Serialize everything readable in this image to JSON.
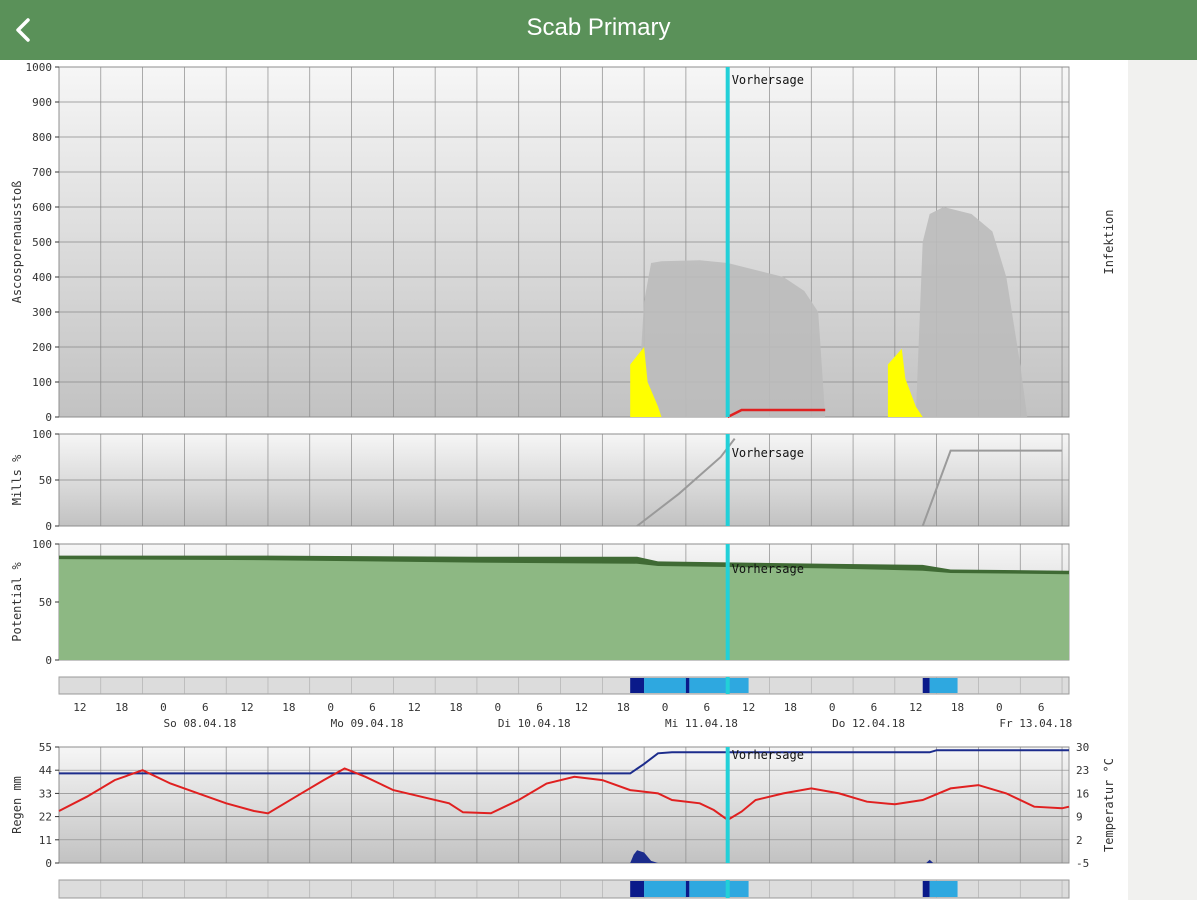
{
  "header": {
    "title": "Scab Primary",
    "back_icon": "chevron-left-icon"
  },
  "colors": {
    "header_bg": "#5a9159",
    "forecast_line": "#22d0d8",
    "ascospore": "#ffff00",
    "infection_area": "#bbbbbb",
    "infection_line": "#e02020",
    "potential_light": "#8db883",
    "potential_dark": "#3f6a34",
    "temperature": "#e02020",
    "humidity": "#1c2c8c",
    "wet_dark": "#0a1a8a",
    "wet_light": "#2ea8e0"
  },
  "forecast_label": "Vorhersage",
  "time_axis": {
    "hour_labels": [
      "12",
      "18",
      "0",
      "6",
      "12",
      "18",
      "0",
      "6",
      "12",
      "18",
      "0",
      "6",
      "12",
      "18",
      "0",
      "6",
      "12",
      "18",
      "0",
      "6",
      "12",
      "18",
      "0",
      "6"
    ],
    "day_labels": [
      "So 08.04.18",
      "Mo 09.04.18",
      "Di 10.04.18",
      "Mi 11.04.18",
      "Do 12.04.18",
      "Fr 13.04.18"
    ]
  },
  "chart_data": [
    {
      "type": "area",
      "ylabel": "Ascosporenausstoß",
      "ylabel_right": "Infektion",
      "ylim": [
        0,
        1000
      ],
      "y_ticks": [
        "0",
        "100",
        "200",
        "300",
        "400",
        "500",
        "600",
        "700",
        "800",
        "900",
        "1000"
      ],
      "forecast_label": "Vorhersage",
      "x_unit": "hours",
      "xlim": [
        0,
        145
      ],
      "forecast_x": 96,
      "grid": true,
      "series": [
        {
          "values_xy": [
            [
              82,
              0
            ],
            [
              82,
              150
            ],
            [
              84,
              200
            ],
            [
              84.5,
              100
            ],
            [
              86,
              30
            ],
            [
              86.5,
              0
            ]
          ]
        },
        {
          "values_xy": [
            [
              119,
              0
            ],
            [
              119,
              150
            ],
            [
              121,
              195
            ],
            [
              121.5,
              110
            ],
            [
              123,
              30
            ],
            [
              124,
              0
            ]
          ]
        },
        {
          "values_xy": [
            [
              83,
              0
            ],
            [
              84,
              330
            ],
            [
              85,
              440
            ],
            [
              86.5,
              445
            ],
            [
              92,
              448
            ],
            [
              96,
              440
            ],
            [
              100,
              420
            ],
            [
              104,
              400
            ],
            [
              107,
              360
            ],
            [
              109,
              300
            ],
            [
              110,
              0
            ]
          ]
        },
        {
          "values_xy": [
            [
              123,
              0
            ],
            [
              124,
              500
            ],
            [
              125,
              580
            ],
            [
              127,
              600
            ],
            [
              131,
              580
            ],
            [
              134,
              530
            ],
            [
              136,
              400
            ],
            [
              138,
              150
            ],
            [
              139,
              0
            ]
          ]
        },
        {
          "values_xy": [
            [
              96,
              0
            ],
            [
              98,
              20
            ],
            [
              110,
              20
            ]
          ]
        }
      ]
    },
    {
      "type": "line",
      "ylabel": "Mills %",
      "ylim": [
        0,
        100
      ],
      "y_ticks": [
        "0",
        "50",
        "100"
      ],
      "forecast_label": "Vorhersage",
      "x_unit": "hours",
      "xlim": [
        0,
        145
      ],
      "forecast_x": 96,
      "grid": true,
      "series": [
        {
          "values_xy": [
            [
              83,
              0
            ],
            [
              89,
              35
            ],
            [
              95,
              75
            ],
            [
              97,
              95
            ]
          ]
        },
        {
          "values_xy": [
            [
              124,
              0
            ],
            [
              128,
              82
            ],
            [
              144,
              82
            ]
          ]
        }
      ]
    },
    {
      "type": "area",
      "ylabel": "Potential %",
      "ylim": [
        0,
        100
      ],
      "y_ticks": [
        "0",
        "50",
        "100"
      ],
      "forecast_label": "Vorhersage",
      "x_unit": "hours",
      "xlim": [
        0,
        145
      ],
      "forecast_x": 96,
      "grid": true,
      "series": [
        {
          "values_xy": [
            [
              0,
              90
            ],
            [
              30,
              90
            ],
            [
              60,
              89
            ],
            [
              83,
              89
            ],
            [
              86,
              85
            ],
            [
              110,
              83
            ],
            [
              124,
              82
            ],
            [
              128,
              78
            ],
            [
              145,
              77
            ]
          ]
        },
        {
          "values_xy": [
            [
              0,
              87
            ],
            [
              30,
              86
            ],
            [
              60,
              84
            ],
            [
              83,
              83
            ],
            [
              86,
              81
            ],
            [
              110,
              79
            ],
            [
              124,
              77
            ],
            [
              128,
              75
            ],
            [
              145,
              74
            ]
          ]
        }
      ]
    },
    {
      "type": "line",
      "ylabel": "Regen mm",
      "ylabel_right": "Temperatur °C",
      "ylim": [
        0,
        55
      ],
      "ylim_right": [
        -5,
        30
      ],
      "y_ticks": [
        "0",
        "11",
        "22",
        "33",
        "44",
        "55"
      ],
      "y_ticks_right": [
        "-5",
        "2",
        "9",
        "16",
        "23",
        "30"
      ],
      "forecast_label": "Vorhersage",
      "x_unit": "hours",
      "xlim": [
        0,
        145
      ],
      "forecast_x": 96,
      "grid": true,
      "series": [
        {
          "values_xy": [
            [
              0,
              10.7
            ],
            [
              4,
              15
            ],
            [
              8,
              20
            ],
            [
              12,
              23
            ],
            [
              16,
              19
            ],
            [
              20,
              16
            ],
            [
              24,
              13
            ],
            [
              28,
              10.7
            ],
            [
              30,
              10
            ],
            [
              34,
              15
            ],
            [
              38,
              20
            ],
            [
              41,
              23.5
            ],
            [
              44,
              21
            ],
            [
              48,
              17
            ],
            [
              52,
              15
            ],
            [
              56,
              13
            ],
            [
              58,
              10.3
            ],
            [
              62,
              10
            ],
            [
              66,
              14
            ],
            [
              70,
              19
            ],
            [
              74,
              21
            ],
            [
              78,
              20
            ],
            [
              82,
              17
            ],
            [
              86,
              16
            ],
            [
              88,
              14
            ],
            [
              92,
              13
            ],
            [
              94,
              11
            ],
            [
              96,
              8
            ],
            [
              98,
              10.5
            ],
            [
              100,
              14
            ],
            [
              104,
              16
            ],
            [
              108,
              17.5
            ],
            [
              112,
              16
            ],
            [
              116,
              13.5
            ],
            [
              120,
              12.7
            ],
            [
              124,
              14
            ],
            [
              128,
              17.5
            ],
            [
              132,
              18.5
            ],
            [
              136,
              16
            ],
            [
              140,
              12
            ],
            [
              144,
              11.5
            ],
            [
              145,
              12
            ]
          ]
        },
        {
          "values_xy": [
            [
              0,
              42.5
            ],
            [
              82,
              42.5
            ],
            [
              84,
              47
            ],
            [
              86,
              52
            ],
            [
              88,
              52.5
            ],
            [
              125,
              52.5
            ],
            [
              126,
              53.5
            ],
            [
              145,
              53.5
            ]
          ]
        },
        {
          "values_xy": [
            [
              82,
              0
            ],
            [
              82.5,
              4
            ],
            [
              83,
              6
            ],
            [
              84,
              5
            ],
            [
              85,
              1
            ],
            [
              86,
              0
            ]
          ]
        },
        {
          "values_xy": [
            [
              124.5,
              0
            ],
            [
              125,
              1.5
            ],
            [
              125.5,
              0
            ]
          ]
        }
      ]
    }
  ],
  "wetness_bars": [
    {
      "start": 82,
      "end": 84,
      "level": "dark"
    },
    {
      "start": 84,
      "end": 90,
      "level": "light"
    },
    {
      "start": 90,
      "end": 90.5,
      "level": "dark"
    },
    {
      "start": 90.5,
      "end": 99,
      "level": "light"
    },
    {
      "start": 124,
      "end": 125,
      "level": "dark"
    },
    {
      "start": 125,
      "end": 129,
      "level": "light"
    }
  ]
}
